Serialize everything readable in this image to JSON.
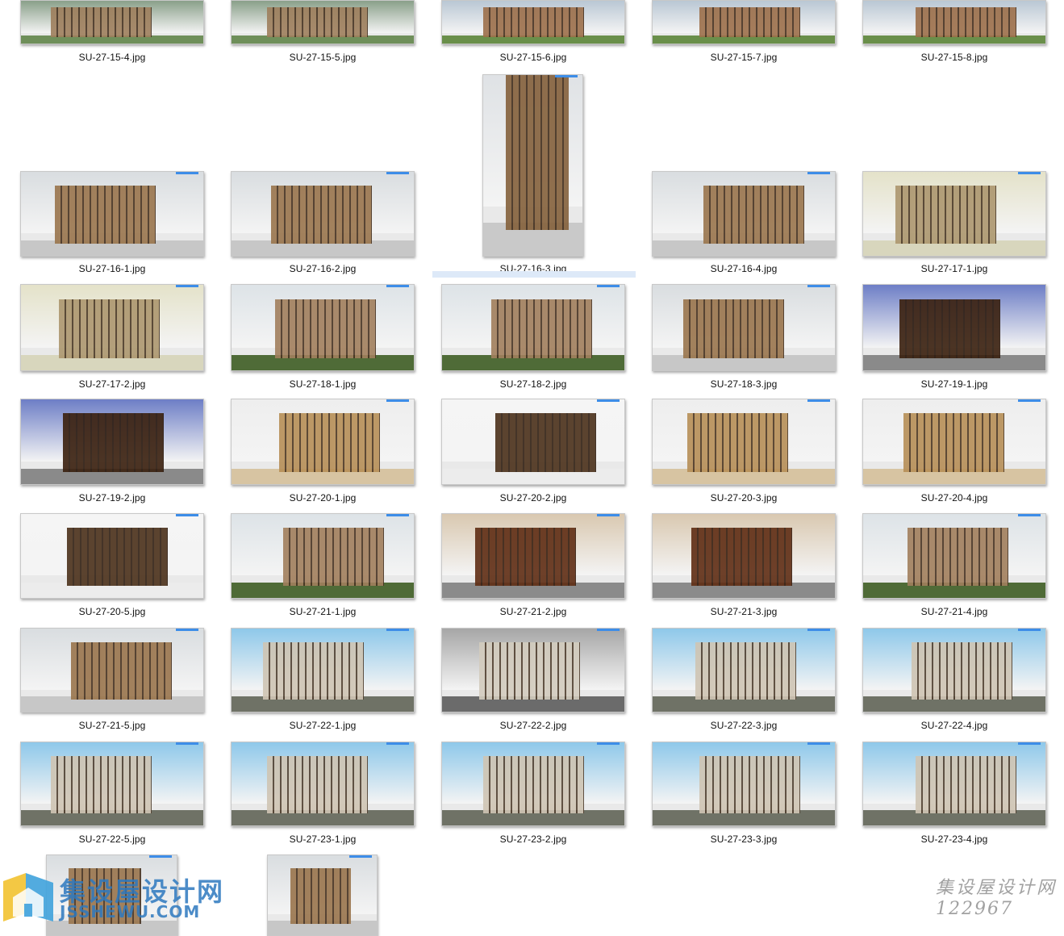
{
  "files": [
    {
      "name": "SU-27-15-4.jpg",
      "style": "aerial"
    },
    {
      "name": "SU-27-15-5.jpg",
      "style": "aerial"
    },
    {
      "name": "SU-27-15-6.jpg",
      "style": "street"
    },
    {
      "name": "SU-27-15-7.jpg",
      "style": "street"
    },
    {
      "name": "SU-27-15-8.jpg",
      "style": "street"
    },
    {
      "name": "SU-27-16-1.jpg",
      "style": "grey"
    },
    {
      "name": "SU-27-16-2.jpg",
      "style": "grey"
    },
    {
      "name": "SU-27-16-3.jpg",
      "style": "tower"
    },
    {
      "name": "SU-27-16-4.jpg",
      "style": "grey"
    },
    {
      "name": "SU-27-17-1.jpg",
      "style": "beige"
    },
    {
      "name": "SU-27-17-2.jpg",
      "style": "beige"
    },
    {
      "name": "SU-27-18-1.jpg",
      "style": "trees"
    },
    {
      "name": "SU-27-18-2.jpg",
      "style": "trees"
    },
    {
      "name": "SU-27-18-3.jpg",
      "style": "grey"
    },
    {
      "name": "SU-27-19-1.jpg",
      "style": "blue"
    },
    {
      "name": "SU-27-19-2.jpg",
      "style": "blue"
    },
    {
      "name": "SU-27-20-1.jpg",
      "style": "sand"
    },
    {
      "name": "SU-27-20-2.jpg",
      "style": "white"
    },
    {
      "name": "SU-27-20-3.jpg",
      "style": "sand"
    },
    {
      "name": "SU-27-20-4.jpg",
      "style": "sand"
    },
    {
      "name": "SU-27-20-5.jpg",
      "style": "white"
    },
    {
      "name": "SU-27-21-1.jpg",
      "style": "trees"
    },
    {
      "name": "SU-27-21-2.jpg",
      "style": "brown"
    },
    {
      "name": "SU-27-21-3.jpg",
      "style": "brown"
    },
    {
      "name": "SU-27-21-4.jpg",
      "style": "trees"
    },
    {
      "name": "SU-27-21-5.jpg",
      "style": "grey"
    },
    {
      "name": "SU-27-22-1.jpg",
      "style": "sky"
    },
    {
      "name": "SU-27-22-2.jpg",
      "style": "dark"
    },
    {
      "name": "SU-27-22-3.jpg",
      "style": "sky"
    },
    {
      "name": "SU-27-22-4.jpg",
      "style": "sky"
    },
    {
      "name": "SU-27-22-5.jpg",
      "style": "sky"
    },
    {
      "name": "SU-27-23-1.jpg",
      "style": "sky"
    },
    {
      "name": "SU-27-23-2.jpg",
      "style": "sky"
    },
    {
      "name": "SU-27-23-3.jpg",
      "style": "sky"
    },
    {
      "name": "SU-27-23-4.jpg",
      "style": "sky"
    },
    {
      "name": "",
      "style": "grey"
    },
    {
      "name": "",
      "style": "grey"
    }
  ],
  "watermark": {
    "site_cn": "集设屋设计网",
    "site_en": "JSSHEWU.COM",
    "right_cn": "集设屋设计网",
    "right_id": "122967"
  },
  "colors": {
    "accent_bar": "#3d8de8",
    "selection": "#dde9f8"
  }
}
